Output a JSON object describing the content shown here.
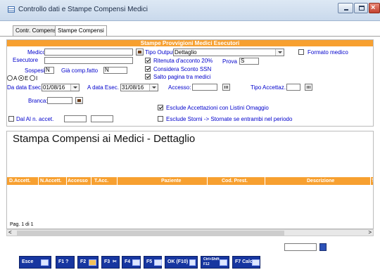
{
  "window": {
    "title": "Controllo dati e Stampe Compensi Medici"
  },
  "tabs": [
    {
      "label": "Contr. Compensi"
    },
    {
      "label": "Stampe Compensi"
    }
  ],
  "panel": {
    "header": "Stampe Provvigioni Medici Esecutori",
    "medico_label": "Medico",
    "esecutore_label": "Esecutore",
    "sospesi_label": "Sospesi",
    "sospesi_value": "N",
    "gia_comp_label": "Già comp.fatto",
    "gia_comp_value": "N",
    "radio_a": "A",
    "radio_e": "E",
    "radio_i": "I",
    "da_data_label": "Da data Esec.",
    "da_data_value": "01/08/16",
    "a_data_label": "A data Esec.",
    "a_data_value": "31/08/16",
    "accesso_label": "Accesso:",
    "tipo_accettaz_label": "Tipo Accettaz.:",
    "branca_label": "Branca:",
    "dal_al_label": "Dal Al n. accet.",
    "tipo_output_label": "Tipo Output",
    "tipo_output_value": "Dettaglio",
    "formato_medico_label": "Formato medico",
    "ritenuta_label": "Ritenuta d'acconto 20%",
    "prova_label": "Prova",
    "prova_value": "S",
    "sconto_label": "Considera Sconto SSN",
    "salto_label": "Salto pagina tra medici",
    "esclude_omaggio_label": "Esclude Accettazioni con Listini Omaggio",
    "esclude_storni_label": "Esclude Storni -> Stornate se entrambi nel periodo"
  },
  "checks": {
    "formato_medico": false,
    "ritenuta": true,
    "sconto": true,
    "salto": true,
    "dal_al": false,
    "esclude_omaggio": true,
    "esclude_storni": false
  },
  "report": {
    "title": "Stampa Compensi ai Medici - Dettaglio",
    "columns": [
      "D.Accett.",
      "N.Accett.",
      "Accesso",
      "T.Acc.",
      "Paziente",
      "Cod. Prest.",
      "Descrizione",
      "Tr"
    ],
    "pagination": "Pag. 1 di 1"
  },
  "toolbar": [
    {
      "label": "Esce",
      "icon": "exit-icon"
    },
    {
      "label": "F1 ?",
      "icon": "help-icon"
    },
    {
      "label": "F2",
      "icon": "edit-icon"
    },
    {
      "label": "F3",
      "icon": "cut-icon"
    },
    {
      "label": "F4",
      "icon": "window-icon"
    },
    {
      "label": "F5",
      "icon": "window-icon"
    },
    {
      "label": "OK (F10)",
      "icon": "save-icon"
    },
    {
      "label": "Ctrl+Shift F12",
      "icon": "print-icon"
    },
    {
      "label": "F7 Calc.",
      "icon": "calculator-icon"
    }
  ],
  "colors": {
    "accent": "#f7a030",
    "button": "#1736a0"
  }
}
